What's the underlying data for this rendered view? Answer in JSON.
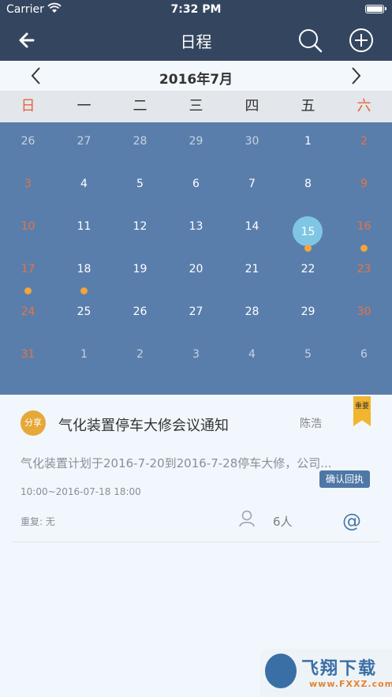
{
  "status_bar": {
    "carrier": "Carrier",
    "time": "7:32 PM"
  },
  "nav": {
    "title": "日程",
    "back_icon": "back-arrow-icon",
    "search_icon": "search-icon",
    "add_icon": "plus-circle-icon"
  },
  "calendar": {
    "month_label": "2016年7月",
    "weekdays": [
      "日",
      "一",
      "二",
      "三",
      "四",
      "五",
      "六"
    ],
    "weeks": [
      [
        "26",
        "27",
        "28",
        "29",
        "30",
        "1",
        "2"
      ],
      [
        "3",
        "4",
        "5",
        "6",
        "7",
        "8",
        "9"
      ],
      [
        "10",
        "11",
        "12",
        "13",
        "14",
        "15",
        "16"
      ],
      [
        "17",
        "18",
        "19",
        "20",
        "21",
        "22",
        "23"
      ],
      [
        "24",
        "25",
        "26",
        "27",
        "28",
        "29",
        "30"
      ],
      [
        "31",
        "1",
        "2",
        "3",
        "4",
        "5",
        "6"
      ]
    ],
    "selected_day": "15",
    "event_dot_days": [
      "15",
      "16",
      "17",
      "18"
    ],
    "colors": {
      "grid_bg": "#5a7eac",
      "weekend": "#e8733f",
      "dot": "#f1a53a",
      "selected": "#7fc6e4"
    }
  },
  "event": {
    "share_badge": "分享",
    "title": "气化装置停车大修会议通知",
    "owner": "陈浩",
    "important_label": "重要",
    "description": "气化装置计划于2016-7-20到2016-7-28停车大修，公司...",
    "confirm_label": "确认回执",
    "time": "10:00~2016-07-18 18:00",
    "repeat": "重复: 无",
    "participant_count": "6人",
    "mention_icon": "@"
  },
  "watermark": {
    "text": "飞翔下载",
    "url": "www.FXXZ.com"
  }
}
